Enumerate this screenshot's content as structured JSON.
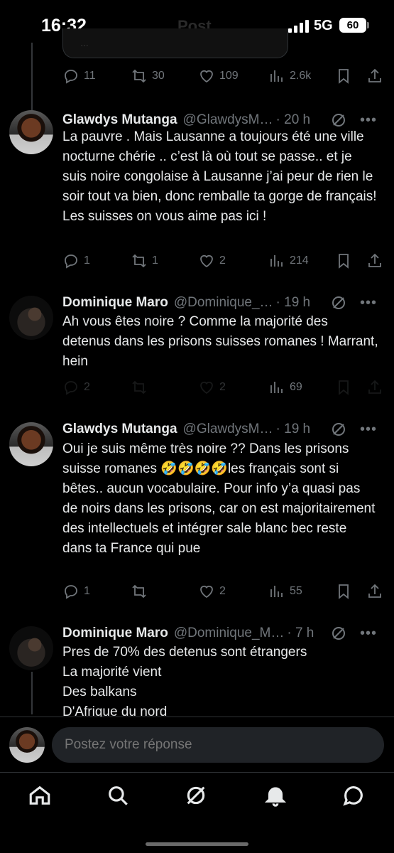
{
  "status_bar": {
    "time": "16:32",
    "faded_title": "Post",
    "network": "5G",
    "battery": "60"
  },
  "previous_post": {
    "card_text": "…",
    "actions": {
      "replies": "11",
      "reposts": "30",
      "likes": "109",
      "views": "2.6k"
    }
  },
  "tweets": [
    {
      "name": "Glawdys Mutanga",
      "handle": "@GlawdysM…",
      "time": "· 20 h",
      "text": "La pauvre . Mais Lausanne a toujours été une ville nocturne chérie .. c’est là où tout se passe.. et je suis noire congolaise à Lausanne j’ai peur de rien le soir tout va bien, donc remballe ta gorge de français! Les suisses on vous aime pas ici !",
      "actions": {
        "replies": "1",
        "reposts": "1",
        "likes": "2",
        "views": "214"
      }
    },
    {
      "name": "Dominique Maro",
      "handle": "@Dominique_…",
      "time": "· 19 h",
      "text": "Ah vous êtes noire ? Comme la majorité des detenus dans les prisons suisses romanes ! Marrant, hein",
      "actions": {
        "replies": "2",
        "reposts": "",
        "likes": "2",
        "views": "69"
      }
    },
    {
      "name": "Glawdys Mutanga",
      "handle": "@GlawdysM…",
      "time": "· 19 h",
      "text": "Oui je suis même très noire ?? Dans les prisons suisse romanes 🤣🤣🤣🤣les français sont si bêtes.. aucun vocabulaire. Pour info y’a quasi pas de noirs dans les prisons, car on est majoritairement des intellectuels et intégrer sale blanc bec reste dans ta France qui pue",
      "actions": {
        "replies": "1",
        "reposts": "",
        "likes": "2",
        "views": "55"
      }
    },
    {
      "name": "Dominique Maro",
      "handle": "@Dominique_M…",
      "time": "· 7 h",
      "text": "Pres de 70% des detenus sont étrangers\nLa majorité vient\nDes balkans\nD'Afrique du nord"
    }
  ],
  "reply_bar": {
    "placeholder": "Postez votre réponse"
  },
  "bottom_nav": [
    "home-icon",
    "search-icon",
    "grok-icon",
    "notifications-icon",
    "messages-icon"
  ]
}
